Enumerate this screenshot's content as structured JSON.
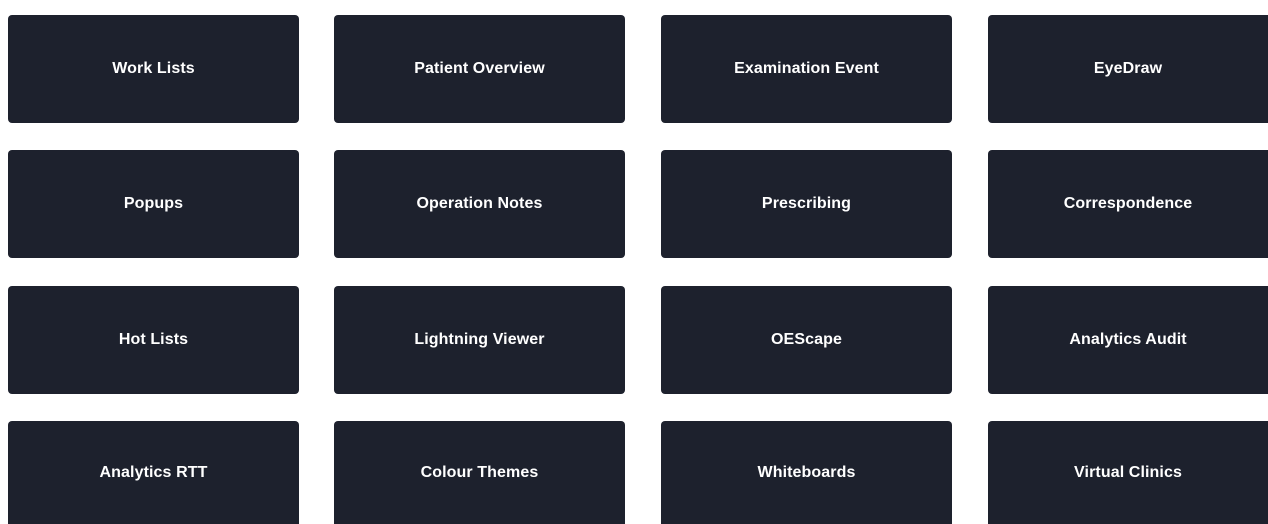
{
  "tiles": [
    {
      "label": "Work Lists"
    },
    {
      "label": "Patient Overview"
    },
    {
      "label": "Examination Event"
    },
    {
      "label": "EyeDraw"
    },
    {
      "label": "Popups"
    },
    {
      "label": "Operation Notes"
    },
    {
      "label": "Prescribing"
    },
    {
      "label": "Correspondence"
    },
    {
      "label": "Hot Lists"
    },
    {
      "label": "Lightning Viewer"
    },
    {
      "label": "OEScape"
    },
    {
      "label": "Analytics Audit"
    },
    {
      "label": "Analytics RTT"
    },
    {
      "label": "Colour Themes"
    },
    {
      "label": "Whiteboards"
    },
    {
      "label": "Virtual Clinics"
    }
  ],
  "colors": {
    "tile_background": "#1d212d",
    "tile_text": "#ffffff",
    "page_background": "#ffffff"
  }
}
